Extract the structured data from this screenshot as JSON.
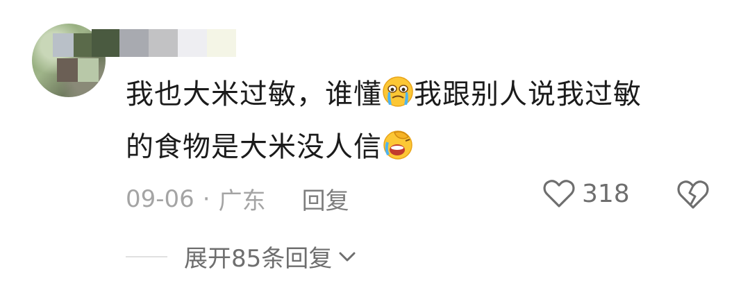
{
  "comment": {
    "line1_a": "我也大米过敏，谁懂",
    "line1_b": "我跟别人说我过敏",
    "line2": "的食物是大米没人信",
    "emoji1": "crying-face-icon",
    "emoji2": "facepalm-laugh-icon"
  },
  "meta": {
    "date": "09-06",
    "separator": "·",
    "location": "广东",
    "reply": "回复"
  },
  "likes": {
    "count": "318"
  },
  "expand": {
    "label": "展开85条回复"
  },
  "colors": {
    "text": "#1b1b1b",
    "meta": "#a4a4a4",
    "action": "#6e6e6e"
  }
}
